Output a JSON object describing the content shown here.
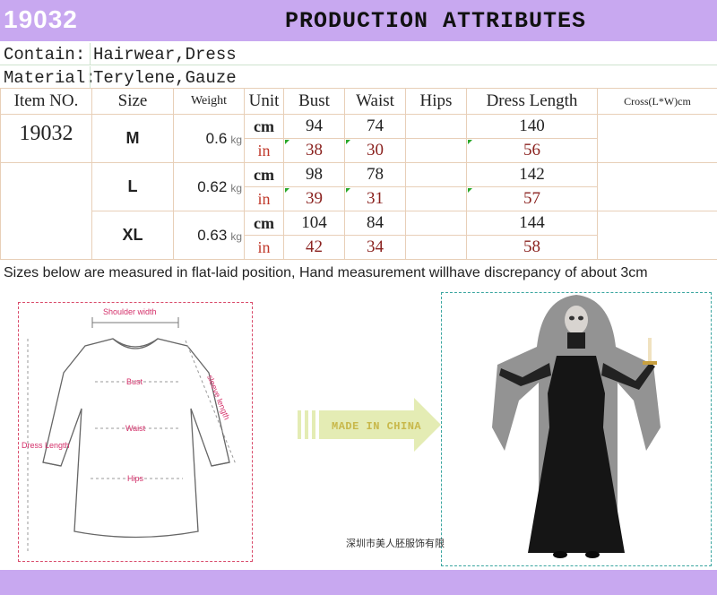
{
  "header": {
    "item_code": "19032",
    "title": "PRODUCTION ATTRIBUTES"
  },
  "attributes": [
    {
      "label": "Contain:",
      "value": "Hairwear,Dress"
    },
    {
      "label": "Material:",
      "value": "Terylene,Gauze"
    }
  ],
  "size_table": {
    "headers": {
      "item_no": "Item NO.",
      "size": "Size",
      "weight": "Weight",
      "unit": "Unit",
      "bust": "Bust",
      "waist": "Waist",
      "hips": "Hips",
      "dress_length": "Dress Length",
      "cross": "Cross(L*W)cm"
    },
    "item_no": "19032",
    "weight_unit": "kg",
    "unit_cm": "cm",
    "unit_in": "in",
    "rows": [
      {
        "size": "M",
        "weight": "0.6",
        "cm": {
          "bust": "94",
          "waist": "74",
          "hips": "",
          "length": "140"
        },
        "in": {
          "bust": "38",
          "waist": "30",
          "hips": "",
          "length": "56"
        }
      },
      {
        "size": "L",
        "weight": "0.62",
        "cm": {
          "bust": "98",
          "waist": "78",
          "hips": "",
          "length": "142"
        },
        "in": {
          "bust": "39",
          "waist": "31",
          "hips": "",
          "length": "57"
        }
      },
      {
        "size": "XL",
        "weight": "0.63",
        "cm": {
          "bust": "104",
          "waist": "84",
          "hips": "",
          "length": "144"
        },
        "in": {
          "bust": "42",
          "waist": "34",
          "hips": "",
          "length": "58"
        }
      }
    ]
  },
  "note": "Sizes below are measured in flat-laid position, Hand measurement willhave discrepancy of about 3cm",
  "diagram": {
    "shoulder_width": "Shoulder width",
    "bust": "Bust",
    "waist": "Waist",
    "hips": "Hips",
    "dress_length": "Dress Length",
    "sleeve_length": "sleeve length"
  },
  "arrow_text": "MADE IN CHINA",
  "company": "深圳市美人胚服饰有限",
  "colors": {
    "accent": "#c8a8f0",
    "diagram_red": "#d4306a",
    "arrow_green": "#e4ecb4"
  }
}
